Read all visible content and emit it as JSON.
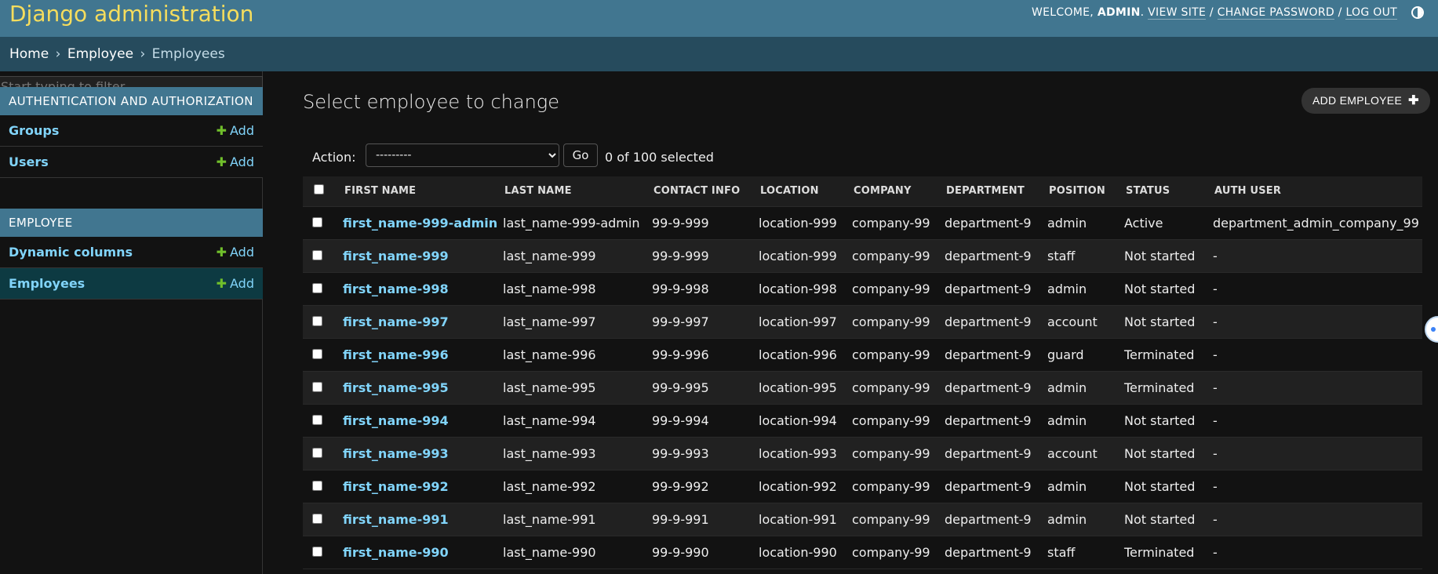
{
  "header": {
    "site_title": "Django administration",
    "welcome": "Welcome,",
    "username": "admin",
    "view_site": "View site",
    "change_password": "Change password",
    "log_out": "Log out"
  },
  "breadcrumbs": {
    "home": "Home",
    "app": "Employee",
    "model": "Employees",
    "separator": "›"
  },
  "sidebar": {
    "filter_placeholder": "Start typing to filter...",
    "modules": [
      {
        "caption": "Authentication and Authorization",
        "items": [
          {
            "label": "Groups",
            "add": "Add"
          },
          {
            "label": "Users",
            "add": "Add"
          }
        ]
      },
      {
        "caption": "Employee",
        "items": [
          {
            "label": "Dynamic columns",
            "add": "Add"
          },
          {
            "label": "Employees",
            "add": "Add",
            "current": true
          }
        ]
      }
    ]
  },
  "main": {
    "title": "Select employee to change",
    "add_button": "Add Employee",
    "action_label": "Action:",
    "action_selected": "---------",
    "go_label": "Go",
    "selected_count": "0 of 100 selected",
    "columns": [
      "First name",
      "Last name",
      "Contact info",
      "Location",
      "Company",
      "Department",
      "Position",
      "Status",
      "Auth user"
    ],
    "rows": [
      [
        "first_name-999-admin",
        "last_name-999-admin",
        "99-9-999",
        "location-999",
        "company-99",
        "department-9",
        "admin",
        "Active",
        "department_admin_company_99"
      ],
      [
        "first_name-999",
        "last_name-999",
        "99-9-999",
        "location-999",
        "company-99",
        "department-9",
        "staff",
        "Not started",
        "-"
      ],
      [
        "first_name-998",
        "last_name-998",
        "99-9-998",
        "location-998",
        "company-99",
        "department-9",
        "admin",
        "Not started",
        "-"
      ],
      [
        "first_name-997",
        "last_name-997",
        "99-9-997",
        "location-997",
        "company-99",
        "department-9",
        "account",
        "Not started",
        "-"
      ],
      [
        "first_name-996",
        "last_name-996",
        "99-9-996",
        "location-996",
        "company-99",
        "department-9",
        "guard",
        "Terminated",
        "-"
      ],
      [
        "first_name-995",
        "last_name-995",
        "99-9-995",
        "location-995",
        "company-99",
        "department-9",
        "admin",
        "Terminated",
        "-"
      ],
      [
        "first_name-994",
        "last_name-994",
        "99-9-994",
        "location-994",
        "company-99",
        "department-9",
        "admin",
        "Not started",
        "-"
      ],
      [
        "first_name-993",
        "last_name-993",
        "99-9-993",
        "location-993",
        "company-99",
        "department-9",
        "account",
        "Not started",
        "-"
      ],
      [
        "first_name-992",
        "last_name-992",
        "99-9-992",
        "location-992",
        "company-99",
        "department-9",
        "admin",
        "Not started",
        "-"
      ],
      [
        "first_name-991",
        "last_name-991",
        "99-9-991",
        "location-991",
        "company-99",
        "department-9",
        "admin",
        "Not started",
        "-"
      ],
      [
        "first_name-990",
        "last_name-990",
        "99-9-990",
        "location-990",
        "company-99",
        "department-9",
        "staff",
        "Terminated",
        "-"
      ]
    ]
  },
  "icons": {
    "add": "plus-icon",
    "theme": "theme-toggle-icon"
  },
  "colors": {
    "header_bg": "#417690",
    "title": "#f5dd5d",
    "breadcrumbs_bg": "#264b5d",
    "link": "#81d4fa",
    "add_plus": "#70bf2b"
  }
}
